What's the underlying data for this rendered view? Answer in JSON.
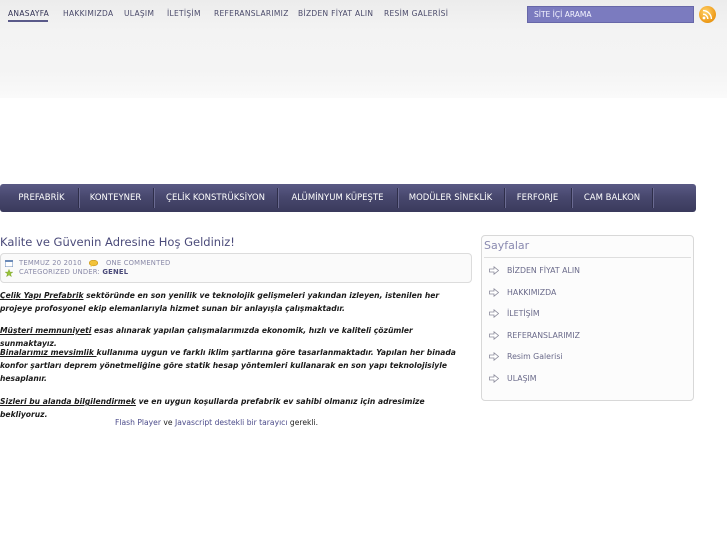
{
  "topnav": {
    "items": [
      "ANASAYFA",
      "HAKKIMIZDA",
      "ULAŞIM",
      "İLETİŞİM",
      "REFERANSLARIMIZ",
      "BİZDEN FİYAT ALIN",
      "RESİM GALERİSİ"
    ],
    "active": "ANASAYFA"
  },
  "search": {
    "placeholder": "SİTE İÇİ ARAMA"
  },
  "mainnav": {
    "items": [
      "PREFABRİK",
      "KONTEYNER",
      "ÇELİK KONSTRÜKSİYON",
      "ALÜMİNYUM KÜPEŞTE",
      "MODÜLER SİNEKLİK",
      "FERFORJE",
      "CAM BALKON"
    ]
  },
  "post": {
    "title": "Kalite ve Güvenin Adresine Hoş Geldiniz!",
    "date": "TEMMUZ 20 2010",
    "comments": "ONE COMMENTED",
    "category_prefix": "CATEGORIZED UNDER:",
    "category": "GENEL",
    "p1_link": "Çelik Yapı Prefabrik",
    "p1_rest": " sektöründe en son yenilik ve teknolojik gelişmeleri yakından izleyen, istenilen her projeye profosyonel ekip elemanlarıyla hizmet sunan bir anlayışla çalışmaktadır.",
    "p2_link": "Müşteri memnuniyeti",
    "p2_rest": " esas alınarak yapılan çalışmalarımızda ekonomik, hızlı ve kaliteli çözümler sunmaktayız.",
    "p3_link": "Binalarımız mevsimlik ",
    "p3_rest": "kullanıma uygun ve farklı iklim şartlarına göre tasarlanmaktadır. Yapılan her binada konfor şartları deprem yönetmeliğine göre statik hesap yöntemleri kullanarak en son yapı teknolojisiyle hesaplanır.",
    "p4_link": "Sizleri bu alanda bilgilendirmek",
    "p4_rest": " ve en uygun koşullarda prefabrik ev sahibi olmanız için adresimize bekliyoruz.",
    "flash_link1": "Flash Player",
    "flash_ve": " ve ",
    "flash_link2": "Javascript destekli bir tarayıcı",
    "flash_rest": " gerekli."
  },
  "sidebar": {
    "title": "Sayfalar",
    "items": [
      "BİZDEN FİYAT ALIN",
      "HAKKIMIZDA",
      "İLETİŞİM",
      "REFERANSLARIMIZ",
      "Resim Galerisi",
      "ULAŞIM"
    ]
  },
  "colors": {
    "nav_bg": "#48486e",
    "accent": "#4b4b7a",
    "search_bg": "#7b7bbf"
  }
}
